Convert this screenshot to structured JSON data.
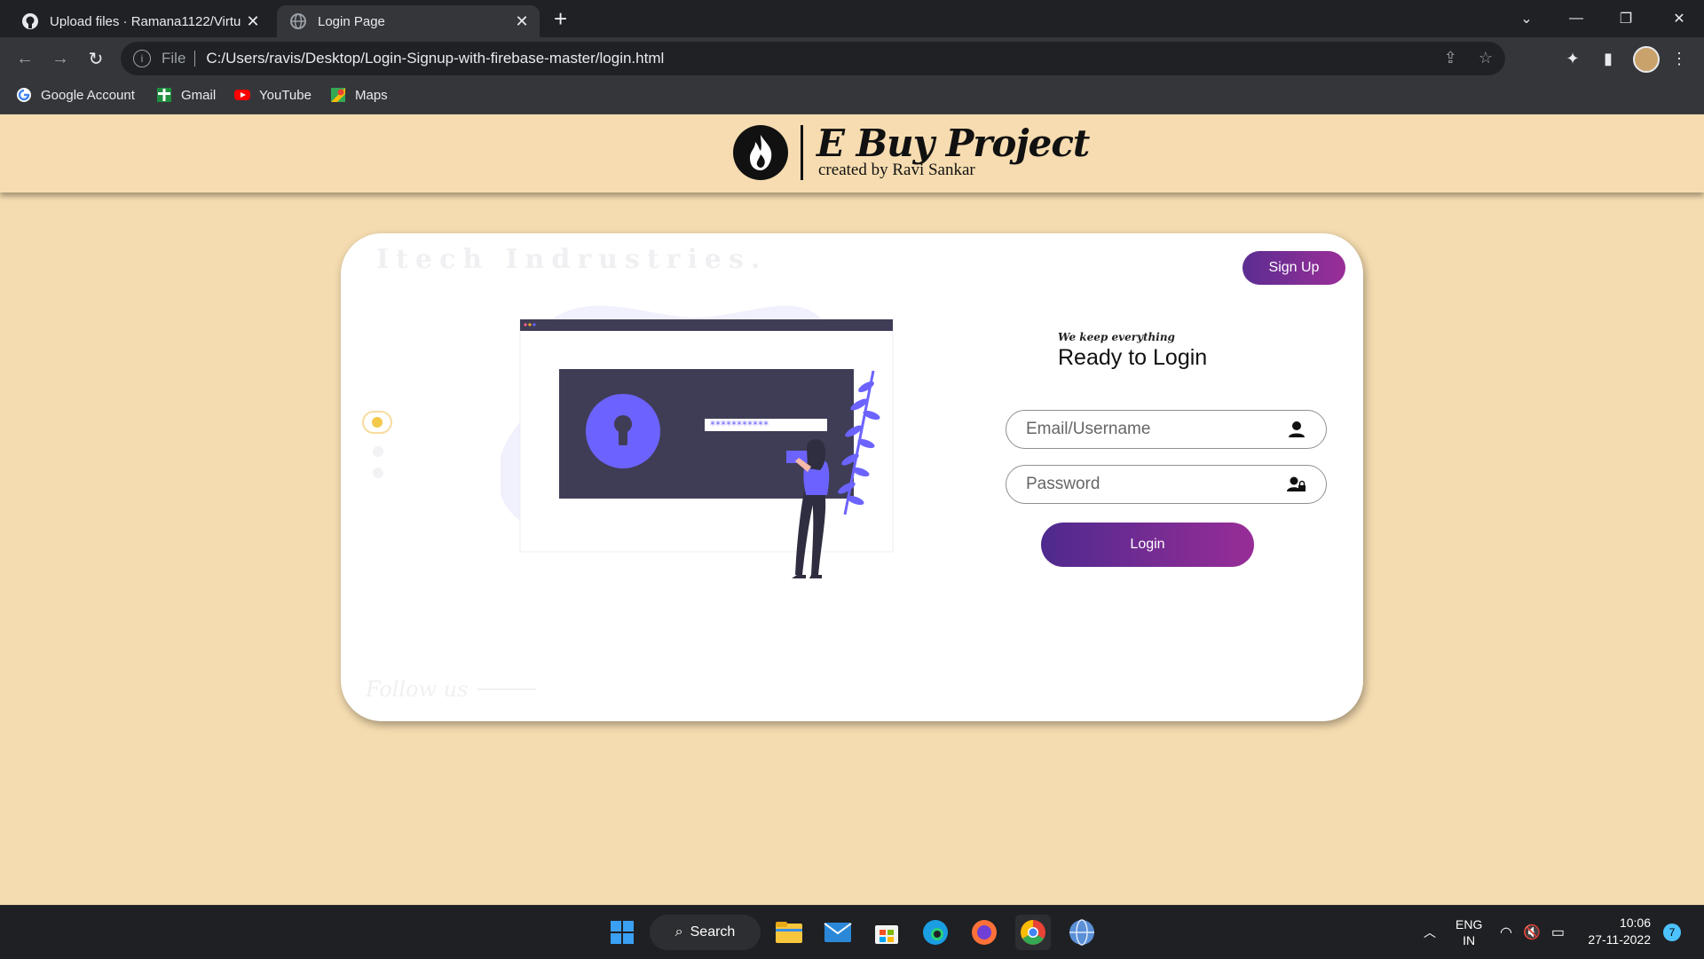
{
  "browser": {
    "tabs": [
      {
        "title": "Upload files · Ramana1122/Virtu",
        "active": false
      },
      {
        "title": "Login Page",
        "active": true
      }
    ],
    "address": {
      "scheme_label": "File",
      "url": "C:/Users/ravis/Desktop/Login-Signup-with-firebase-master/login.html"
    },
    "bookmarks": [
      {
        "label": "Google Account",
        "icon": "google-icon"
      },
      {
        "label": "Gmail",
        "icon": "gmail-icon"
      },
      {
        "label": "YouTube",
        "icon": "youtube-icon"
      },
      {
        "label": "Maps",
        "icon": "maps-icon"
      }
    ]
  },
  "header": {
    "brand": "E Buy Project",
    "credit": "created by Ravi Sankar"
  },
  "card": {
    "watermark": "Itech Indrustries.",
    "follow": "Follow us",
    "signup_label": "Sign Up",
    "tagline": "We keep everything",
    "heading": "Ready to Login",
    "email_placeholder": "Email/Username",
    "password_placeholder": "Password",
    "login_label": "Login",
    "illustration_mask": "***********"
  },
  "taskbar": {
    "search_label": "Search",
    "lang_top": "ENG",
    "lang_bottom": "IN",
    "time": "10:06",
    "date": "27-11-2022",
    "notifications": "7"
  },
  "colors": {
    "page_bg": "#f5dcb0",
    "accent_start": "#5b2d91",
    "accent_end": "#9b2e98",
    "illustration": "#6c63ff",
    "dark_panel": "#3f3d56"
  }
}
